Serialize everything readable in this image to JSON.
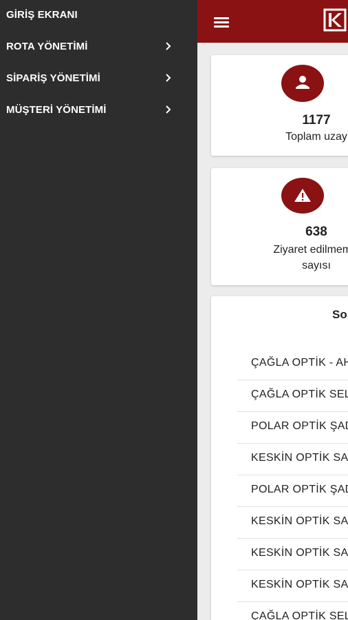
{
  "drawer": {
    "items": [
      {
        "label": "GİRİŞ EKRANI",
        "has_submenu": false
      },
      {
        "label": "ROTA YÖNETİMİ",
        "has_submenu": true
      },
      {
        "label": "SİPARİŞ YÖNETİMİ",
        "has_submenu": true
      },
      {
        "label": "MÜŞTERİ YÖNETİMİ",
        "has_submenu": true
      }
    ]
  },
  "colors": {
    "accent": "#8b1212",
    "drawer_bg": "#2d2d2d",
    "content_bg": "#ececec"
  },
  "stats": [
    {
      "icon": "user-icon",
      "value": "1177",
      "label": "Toplam uzay"
    },
    {
      "icon": "warning-icon",
      "value": "638",
      "label_line1": "Ziyaret edilmemiş",
      "label_line2": "sayısı"
    }
  ],
  "list": {
    "title": "So",
    "rows": [
      "ÇAĞLA OPTİK - AH",
      "ÇAĞLA OPTİK SELA",
      "POLAR OPTİK ŞAD",
      "KESKİN OPTİK SAA",
      "POLAR OPTİK ŞAD",
      "KESKİN OPTİK SAA",
      "KESKİN OPTİK SAA",
      "KESKİN OPTİK SAA",
      "ÇAĞLA OPTİK SELA"
    ]
  }
}
